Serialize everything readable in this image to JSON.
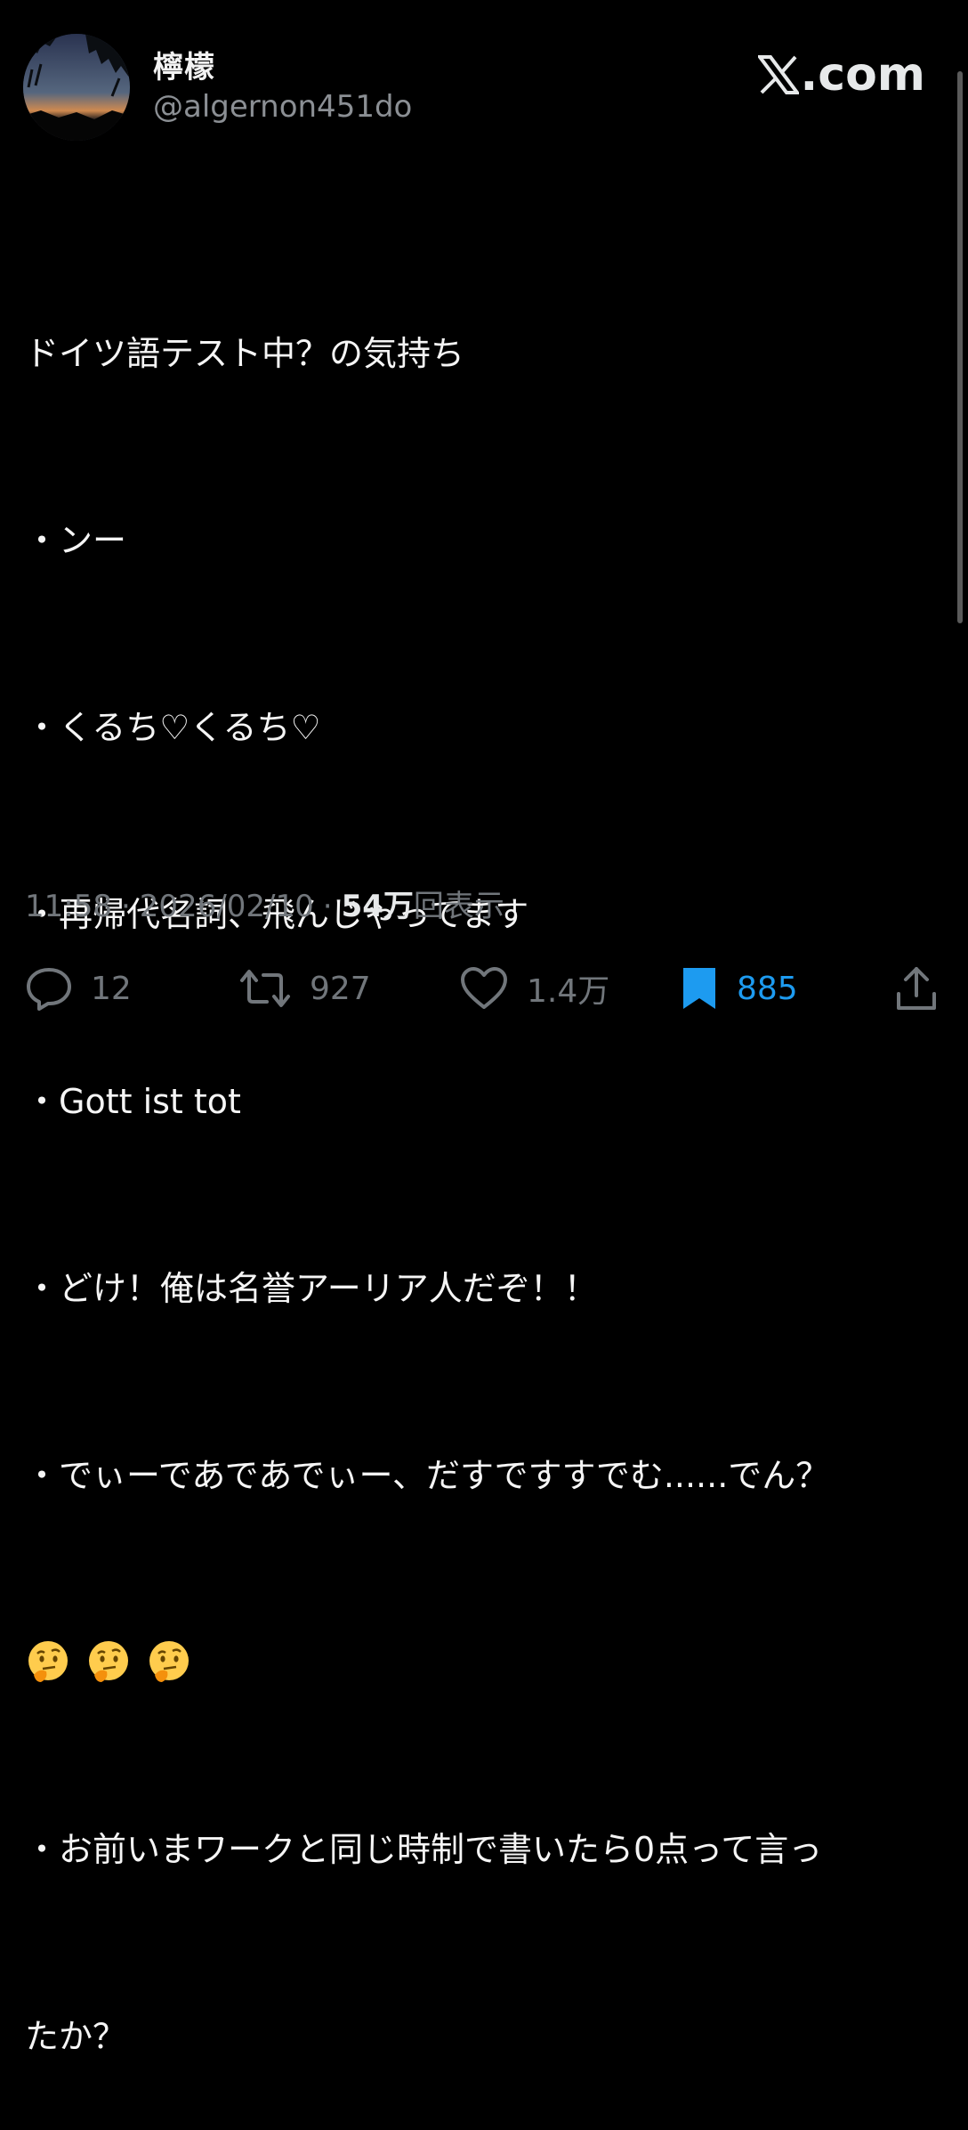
{
  "author": {
    "display_name": "檸檬",
    "handle": "@algernon451do"
  },
  "brand": {
    "label": ".com",
    "icon": "x-logo-icon"
  },
  "tweet": {
    "lines": [
      "ドイツ語テスト中？の気持ち",
      "・ンー",
      "・くるち♡くるち♡",
      "・再帰代名詞、飛んじゃってます",
      "・Gott ist tot",
      "・どけ！俺は名誉アーリア人だぞ！！",
      "・でぃーであであでぃー、だすですすでむ......でん？"
    ],
    "emoji_row": [
      "thinking-face-emoji",
      "thinking-face-emoji",
      "thinking-face-emoji"
    ],
    "lines_after": [
      "・お前いまワークと同じ時制で書いたら0点って言っ",
      "たか？"
    ]
  },
  "meta": {
    "time": "11:58",
    "separator": "·",
    "date": "2026/02/10",
    "views_number": "54万",
    "views_label": "回表示"
  },
  "actions": {
    "replies": "12",
    "retweets": "927",
    "likes": "1.4万",
    "bookmarks": "885"
  },
  "colors": {
    "background": "#000000",
    "text": "#e7e9ea",
    "muted": "#71767b",
    "accent": "#1d9bf0"
  }
}
